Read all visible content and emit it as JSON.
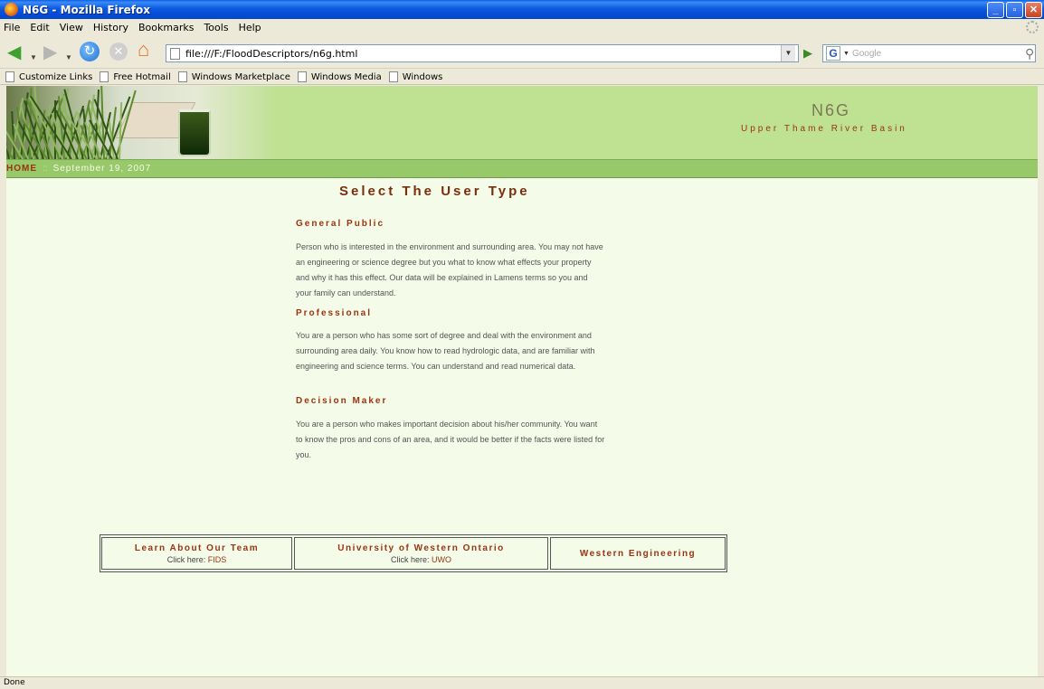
{
  "window": {
    "title": "N6G - Mozilla Firefox",
    "minimize": "_",
    "maximize": "▫",
    "close": "✕"
  },
  "menu": [
    "File",
    "Edit",
    "View",
    "History",
    "Bookmarks",
    "Tools",
    "Help"
  ],
  "toolbar": {
    "url": "file:///F:/FloodDescriptors/n6g.html",
    "search_placeholder": "Google",
    "search_engine_icon": "G"
  },
  "bookmarks": [
    "Customize Links",
    "Free Hotmail",
    "Windows Marketplace",
    "Windows Media",
    "Windows"
  ],
  "site": {
    "title": "N6G",
    "subtitle": "Upper Thame River Basin",
    "nav_home": "HOME",
    "nav_sep": "::",
    "nav_date": "September 19, 2007"
  },
  "main": {
    "heading": "Select The User Type",
    "sections": [
      {
        "title": "General Public",
        "text": "Person who is interested in the environment and surrounding area. You may not have an engineering or science degree but you what to know what effects your property and why it has this effect. Our data will be explained in Lamens terms so you and your family can understand."
      },
      {
        "title": "Professional",
        "text": "You are a person who has some sort of degree and deal with the environment and surrounding area daily. You know how to read hydrologic data, and are familiar with engineering and science terms. You can understand and read numerical data."
      },
      {
        "title": "Decision Maker",
        "text": "You are a person who makes important decision about his/her community. You want to know the pros and cons of an area, and it would be better if the facts were listed for you."
      }
    ]
  },
  "footer_links": [
    {
      "title": "Learn About Our Team",
      "prefix": "Click here:",
      "link": "FIDS"
    },
    {
      "title": "University of Western Ontario",
      "prefix": "Click here:",
      "link": "UWO"
    },
    {
      "title": "Western Engineering"
    }
  ],
  "status": "Done"
}
